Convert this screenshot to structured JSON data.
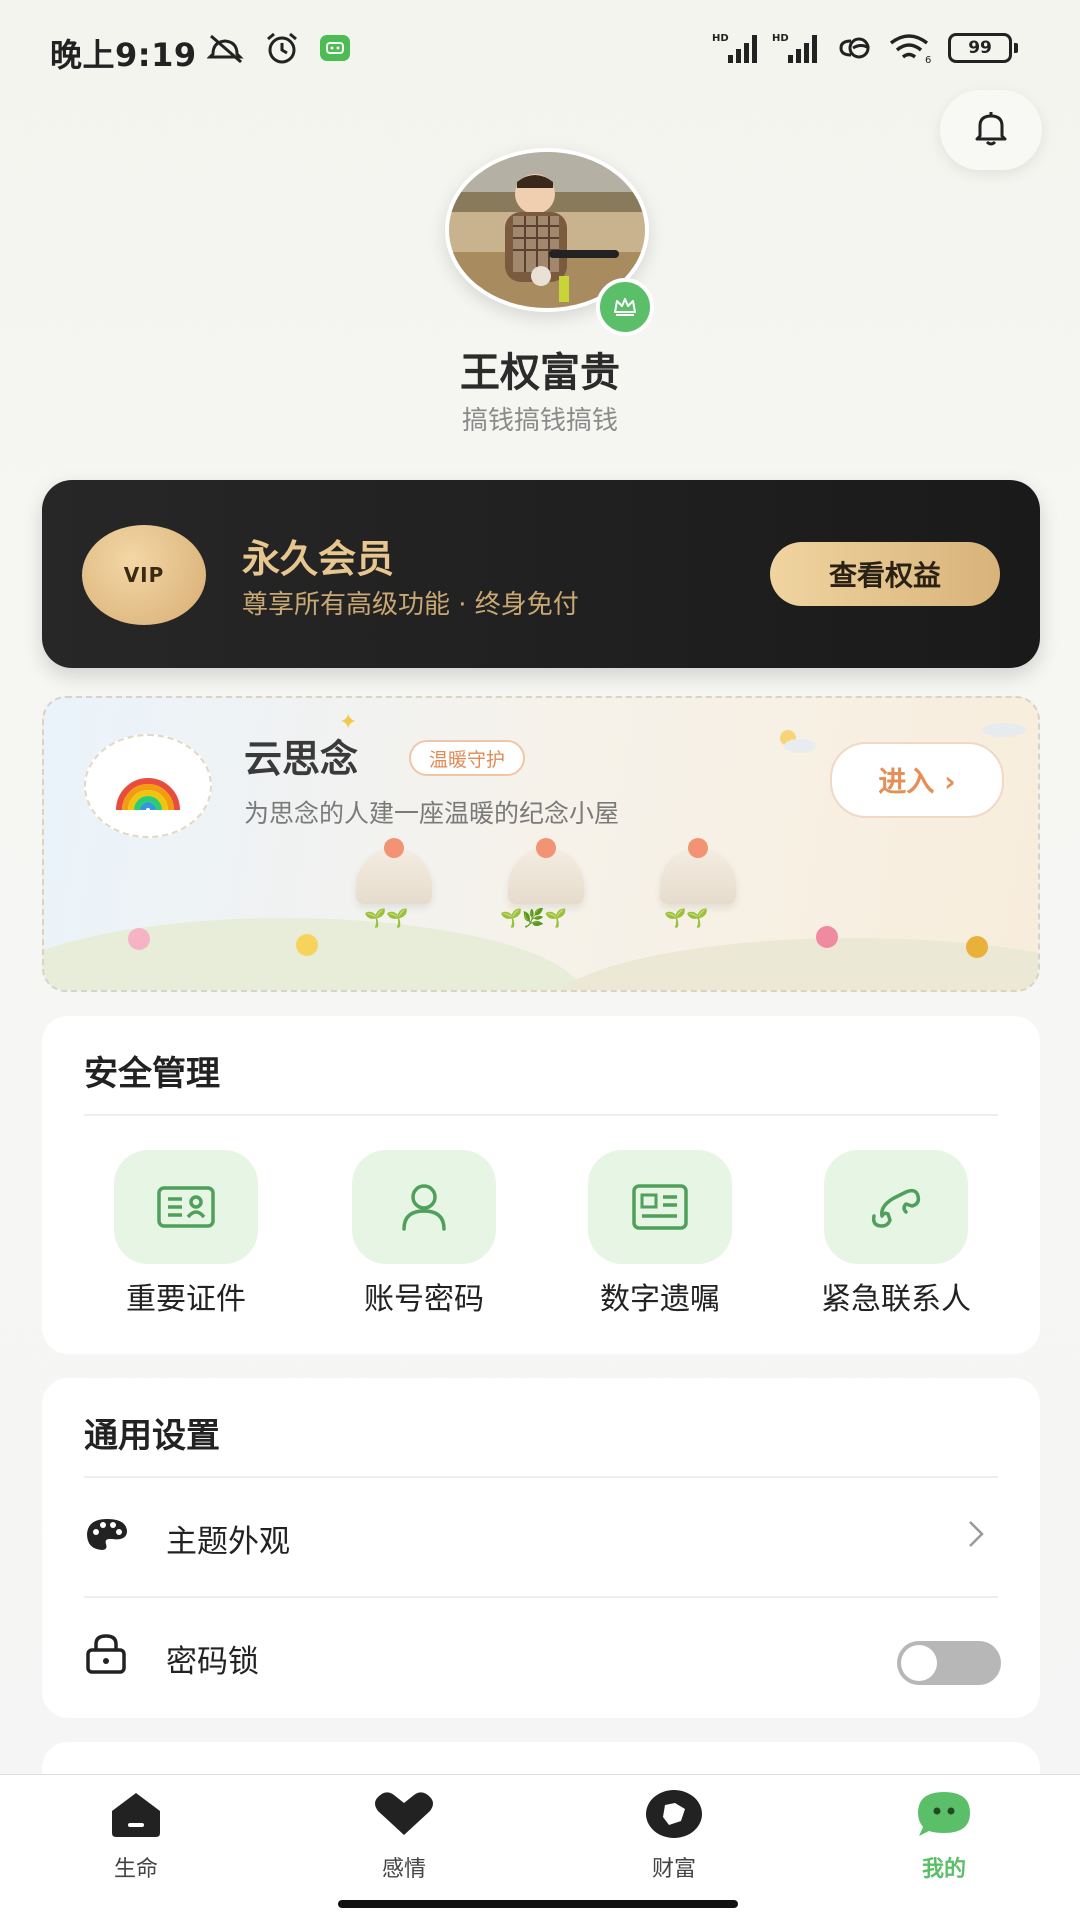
{
  "status_bar": {
    "time": "晚上9:19",
    "battery": "99",
    "network_1": "HD",
    "network_2": "HD"
  },
  "profile": {
    "name": "王权富贵",
    "motto": "搞钱搞钱搞钱"
  },
  "vip": {
    "badge": "VIP",
    "title": "永久会员",
    "subtitle": "尊享所有高级功能 · 终身免付",
    "button": "查看权益"
  },
  "memorial": {
    "title": "云思念",
    "tag": "温暖守护",
    "subtitle": "为思念的人建一座温暖的纪念小屋",
    "button": "进入 ›"
  },
  "security": {
    "title": "安全管理",
    "items": [
      {
        "label": "重要证件",
        "icon": "id-card-icon"
      },
      {
        "label": "账号密码",
        "icon": "user-icon"
      },
      {
        "label": "数字遗嘱",
        "icon": "document-icon"
      },
      {
        "label": "紧急联系人",
        "icon": "phone-icon"
      }
    ]
  },
  "general": {
    "title": "通用设置",
    "rows": [
      {
        "label": "主题外观",
        "icon": "palette-icon",
        "control": "chevron"
      },
      {
        "label": "密码锁",
        "icon": "lock-icon",
        "control": "toggle",
        "toggle_on": false
      }
    ]
  },
  "nav": {
    "items": [
      {
        "label": "生命",
        "icon": "home-icon",
        "active": false
      },
      {
        "label": "感情",
        "icon": "heart-icon",
        "active": false
      },
      {
        "label": "财富",
        "icon": "wealth-icon",
        "active": false
      },
      {
        "label": "我的",
        "icon": "me-icon",
        "active": true
      }
    ]
  },
  "colors": {
    "accent_green": "#5bbf6a",
    "vip_gold": "#e8c68f",
    "memorial_orange": "#e58e56"
  }
}
